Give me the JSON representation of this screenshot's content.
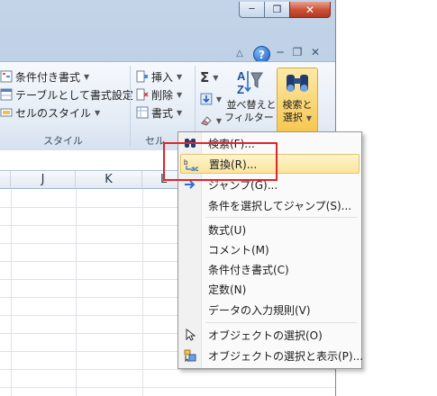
{
  "window_controls": {
    "minimize_label": "─",
    "restore_label": "❐",
    "close_label": "✕"
  },
  "tabbar": {
    "caret_label": "△",
    "help_label": "?",
    "ws_minimize_label": "─",
    "ws_restore_label": "❐",
    "ws_close_label": "✕"
  },
  "ribbon": {
    "style_group": {
      "items": [
        {
          "label": "条件付き書式",
          "arrow": "▼"
        },
        {
          "label": "テーブルとして書式設定",
          "arrow": "▼"
        },
        {
          "label": "セルのスタイル",
          "arrow": "▼"
        }
      ],
      "group_label": "スタイル"
    },
    "cells_group": {
      "items": [
        {
          "label": "挿入",
          "arrow": "▼"
        },
        {
          "label": "削除",
          "arrow": "▼"
        },
        {
          "label": "書式",
          "arrow": "▼"
        }
      ],
      "group_label": "セル"
    },
    "editing_group": {
      "sigma": "Σ",
      "sort_filter_line1": "並べ替えと",
      "sort_filter_line2": "フィルター",
      "find_select_line1": "検索と",
      "find_select_line2": "選択"
    }
  },
  "grid": {
    "columns": [
      "J",
      "K",
      "L"
    ]
  },
  "menu": {
    "items": [
      {
        "label": "検索(F)...",
        "icon": "binoculars-icon"
      },
      {
        "label": "置換(R)...",
        "icon": "replace-icon",
        "highlighted": true
      },
      {
        "label": "ジャンプ(G)...",
        "icon": "goto-arrow-icon"
      },
      {
        "label": "条件を選択してジャンプ(S)...",
        "icon": ""
      },
      {
        "label": "数式(U)",
        "icon": ""
      },
      {
        "label": "コメント(M)",
        "icon": ""
      },
      {
        "label": "条件付き書式(C)",
        "icon": ""
      },
      {
        "label": "定数(N)",
        "icon": ""
      },
      {
        "label": "データの入力規則(V)",
        "icon": ""
      },
      {
        "label": "オブジェクトの選択(O)",
        "icon": "select-objects-icon"
      },
      {
        "label": "オブジェクトの選択と表示(P)...",
        "icon": "selection-pane-icon"
      }
    ]
  },
  "colors": {
    "highlight_fill": "#fbe59a",
    "annotation_red": "#e2232a",
    "ribbon_bg": "#e3ebf5"
  }
}
